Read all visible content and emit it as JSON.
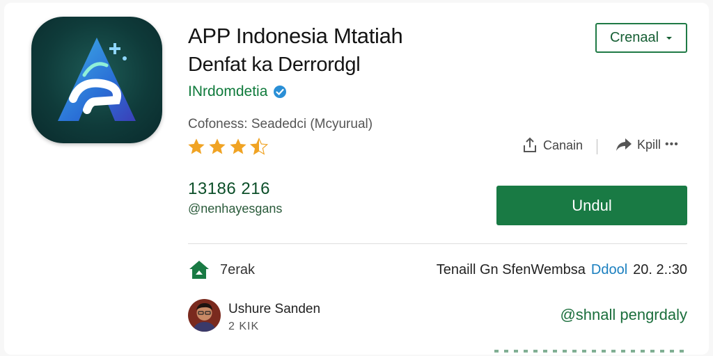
{
  "app": {
    "title": "APP Indonesia Mtatiah",
    "subtitle": "Denfat ka Derrordgl",
    "developer": "INrdomdetia",
    "category": "Cofoness: Seadedci (Mcyurual)",
    "rating": 3.5,
    "downloads_count": "13186 216",
    "downloads_label": "@nenhayesgans"
  },
  "header": {
    "select_label": "Crenaal"
  },
  "actions": {
    "share_label": "Canain",
    "forward_label": "Kpill",
    "more_label": "•••",
    "install_label": "Undul"
  },
  "review_section": {
    "label": "7erak",
    "release_text": "Tenaill Gn SfenWembsa",
    "release_link": "Ddool",
    "release_date": "20. 2.:30"
  },
  "reviewer": {
    "name": "Ushure Sanden",
    "meta": "2 KIK",
    "handle": "@shnall pengrdaly"
  },
  "colors": {
    "accent_green": "#197a44",
    "link_blue": "#1a7fbf",
    "star": "#f0a323",
    "icon_bg": "#0f3b3a"
  },
  "icons": [
    "app-logo-icon",
    "verified-icon",
    "star-icon",
    "chevron-down-icon",
    "share-icon",
    "forward-icon",
    "more-icon",
    "home-icon",
    "avatar"
  ]
}
